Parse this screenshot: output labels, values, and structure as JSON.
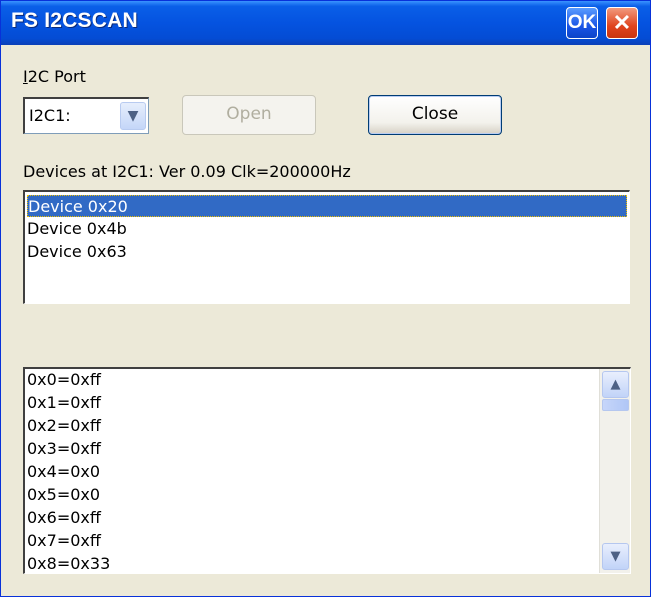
{
  "window": {
    "title": "FS I2CSCAN",
    "ok_label": "OK",
    "close_glyph": "✕"
  },
  "port": {
    "label": "I2C Port",
    "selected": "I2C1:"
  },
  "buttons": {
    "open_label": "Open",
    "close_label": "Close"
  },
  "devices_caption": "Devices at I2C1: Ver 0.09 Clk=200000Hz",
  "devices": [
    "Device 0x20",
    "Device 0x4b",
    "Device 0x63"
  ],
  "selected_device": "Device 0x20",
  "registers": [
    "0x0=0xff",
    "0x1=0xff",
    "0x2=0xff",
    "0x3=0xff",
    "0x4=0x0",
    "0x5=0x0",
    "0x6=0xff",
    "0x7=0xff",
    "0x8=0x33"
  ],
  "icons": {
    "dropdown": "chevron-down-icon",
    "scroll_up": "chevron-up-icon",
    "scroll_down": "chevron-down-icon"
  },
  "colors": {
    "titlebar": "#0553e0",
    "selection": "#316ac5",
    "dialog_bg": "#ece9d8"
  }
}
